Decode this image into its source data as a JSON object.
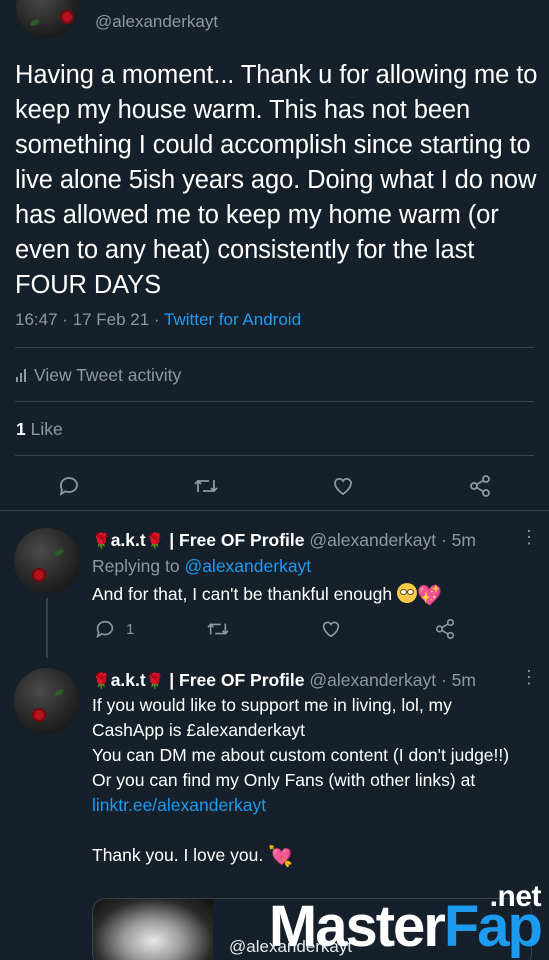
{
  "colors": {
    "background": "#15202b",
    "text_primary": "#ffffff",
    "text_secondary": "#8b98a5",
    "link": "#1d9bf0",
    "divider": "#38444d"
  },
  "main_tweet": {
    "handle": "@alexanderkayt",
    "text": "Having a moment... Thank u for allowing me to keep my house warm. This has not been something I could accomplish since starting to live alone 5ish years ago. Doing what I do now has allowed me to keep my home warm (or even to any heat) consistently for the last FOUR DAYS",
    "timestamp": "16:47 · 17 Feb 21 ·",
    "source": "Twitter for Android",
    "activity_label": "View Tweet activity",
    "likes_count": "1",
    "likes_label": "Like",
    "actions": [
      "reply-icon",
      "retweet-icon",
      "like-icon",
      "share-icon"
    ]
  },
  "replies": [
    {
      "flower": "🌹",
      "name": "a.k.t",
      "name_suffix": "| Free OF Profile",
      "handle": "@alexanderkayt",
      "time": "· 5m",
      "replying_label": "Replying to",
      "replying_to": "@alexanderkayt",
      "text": "And for that, I can't be thankful enough",
      "emoji": [
        "rolling-eyes-emoji",
        "heart-emoji"
      ],
      "reply_count": "1"
    },
    {
      "flower": "🌹",
      "name": "a.k.t",
      "name_suffix": "| Free OF Profile",
      "handle": "@alexanderkayt",
      "time": "· 5m",
      "lines": [
        "If you would like to support me in living, lol, my CashApp is £alexanderkayt",
        "You can DM me about custom content (I don't judge!!)",
        "Or you can find my Only Fans (with other links) at"
      ],
      "link": "linktr.ee/alexanderkayt",
      "closing": "Thank you. I love you.",
      "media_handle": "@alexanderkayt"
    }
  ],
  "watermark": {
    "suffix": ".net",
    "brand_a": "Master",
    "brand_b": "Fap"
  }
}
